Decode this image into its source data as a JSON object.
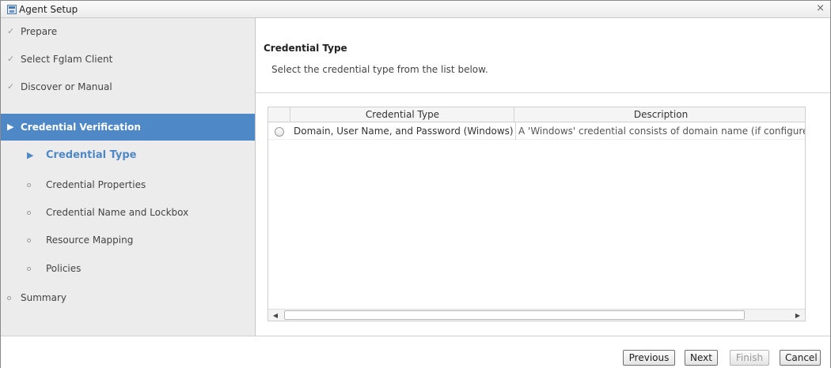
{
  "window": {
    "title": "Agent Setup",
    "close_glyph": "×",
    "app_icon": "agent-setup-icon"
  },
  "sidebar": {
    "steps": [
      {
        "label": "Prepare",
        "state": "done"
      },
      {
        "label": "Select Fglam Client",
        "state": "done"
      },
      {
        "label": "Discover or Manual",
        "state": "done"
      },
      {
        "label": "Credential Verification",
        "state": "active"
      },
      {
        "label": "Credential Type",
        "state": "current"
      },
      {
        "label": "Credential Properties",
        "state": "pending"
      },
      {
        "label": "Credential Name and Lockbox",
        "state": "pending"
      },
      {
        "label": "Resource Mapping",
        "state": "pending"
      },
      {
        "label": "Policies",
        "state": "pending"
      },
      {
        "label": "Summary",
        "state": "pending"
      }
    ],
    "glyphs": {
      "done": "✓",
      "arrow": "▶"
    }
  },
  "main": {
    "title": "Credential Type",
    "description": "Select the credential type from the list below.",
    "table": {
      "columns": [
        "Credential Type",
        "Description"
      ],
      "rows": [
        {
          "type": "Domain, User Name, and Password (Windows)",
          "description": "A 'Windows' credential consists of domain name (if configured i",
          "selected": false
        }
      ]
    },
    "scrollbar": {
      "left": "◀",
      "right": "▶"
    }
  },
  "footer": {
    "previous": "Previous",
    "next": "Next",
    "finish": "Finish",
    "cancel": "Cancel"
  },
  "colors": {
    "accent": "#4f88c6",
    "sidebar_bg": "#ececec"
  }
}
